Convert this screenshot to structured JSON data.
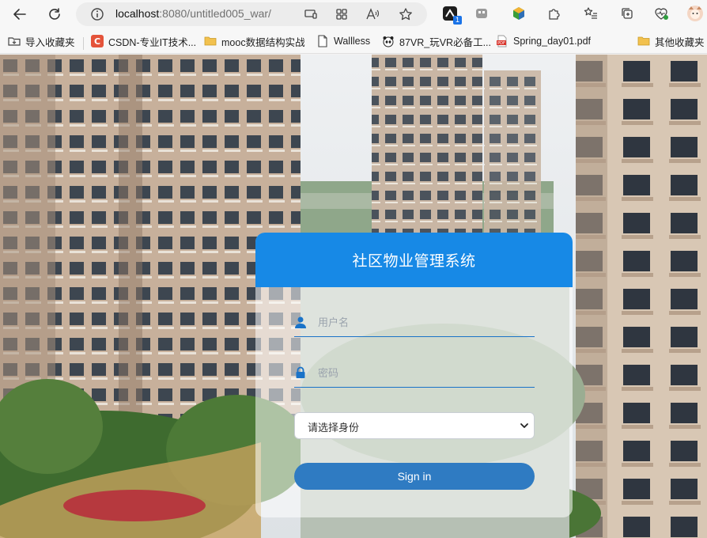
{
  "browser": {
    "url_host": "localhost",
    "url_rest": ":8080/untitled005_war/",
    "extension_badge": "1"
  },
  "bookmarks": [
    {
      "label": "导入收藏夹",
      "icon": "import-folder-icon"
    },
    {
      "label": "CSDN-专业IT技术...",
      "icon": "csdn-logo-icon"
    },
    {
      "label": "mooc数据结构实战",
      "icon": "folder-icon"
    },
    {
      "label": "Wallless",
      "icon": "page-icon"
    },
    {
      "label": "87VR_玩VR必备工...",
      "icon": "panda-icon"
    },
    {
      "label": "Spring_day01.pdf",
      "icon": "pdf-icon"
    },
    {
      "label": "其他收藏夹",
      "icon": "folder-icon"
    }
  ],
  "login": {
    "title": "社区物业管理系统",
    "username_placeholder": "用户名",
    "password_placeholder": "密码",
    "role_select": "请选择身份",
    "signin_label": "Sign in"
  },
  "colors": {
    "header_blue": "#1789e6",
    "button_blue": "#2f7bc2",
    "underline_blue": "#1a73c8"
  }
}
